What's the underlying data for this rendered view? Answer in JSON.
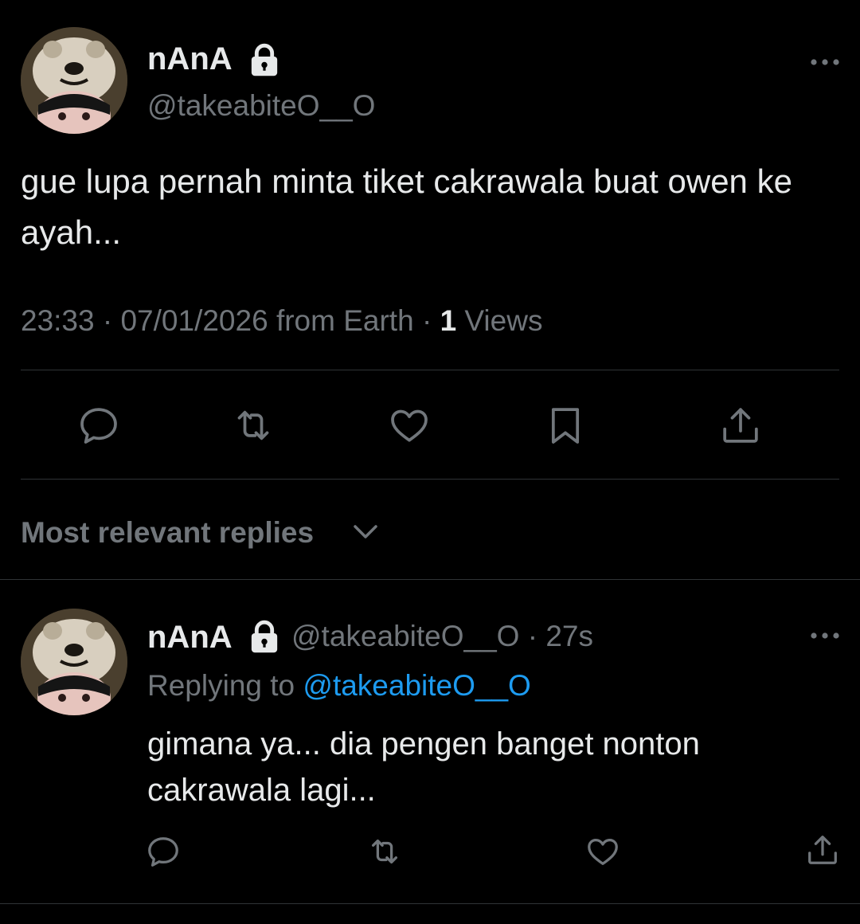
{
  "tweet": {
    "display_name": "nAnA",
    "handle": "@takeabiteO__O",
    "text": "gue lupa pernah minta tiket cakrawala buat owen ke ayah...",
    "time": "23:33",
    "separator": "·",
    "date": "07/01/2026",
    "source": "from Earth",
    "views_count": "1",
    "views_label": "Views"
  },
  "actions": [
    "reply-icon",
    "retweet-icon",
    "like-icon",
    "bookmark-icon",
    "share-icon"
  ],
  "replies_section": {
    "title": "Most relevant replies"
  },
  "reply": {
    "display_name": "nAnA",
    "handle": "@takeabiteO__O",
    "separator": "·",
    "age": "27s",
    "replying_label": "Replying to",
    "replying_handle": "@takeabiteO__O",
    "text": "gimana ya... dia pengen banget nonton cakrawala lagi..."
  },
  "colors": {
    "background": "#000000",
    "primary_text": "#e7e9ea",
    "secondary_text": "#71767b",
    "link": "#1d9bf0",
    "divider": "#2f3336"
  }
}
